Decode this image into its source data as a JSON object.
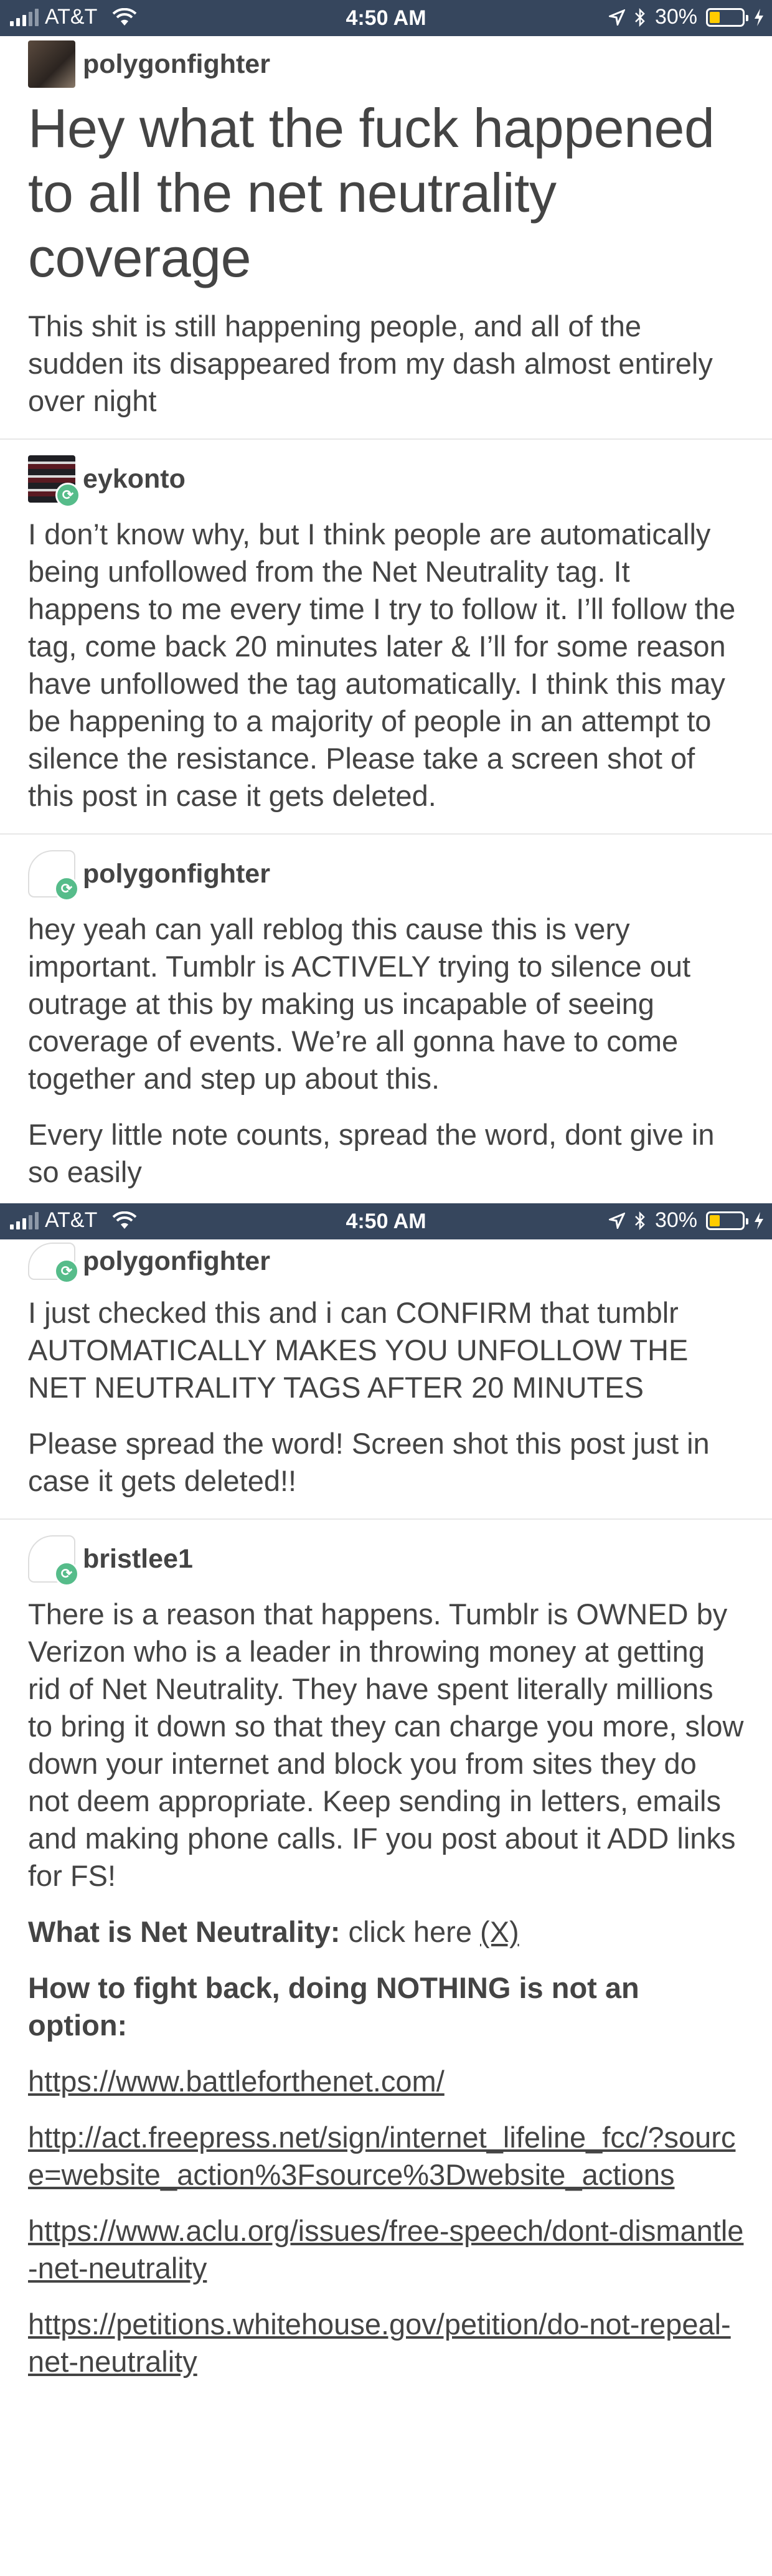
{
  "status_bar_top": {
    "carrier": "AT&T",
    "time": "4:50 AM",
    "battery": "30%",
    "battery_level": 0.3
  },
  "status_bar_mid": {
    "carrier": "AT&T",
    "time": "4:50 AM",
    "battery": "30%",
    "battery_level": 0.3
  },
  "colors": {
    "status_bar": "#36465d",
    "text": "#444444",
    "reblog_badge": "#56bc8a",
    "battery_fill": "#ffcc00"
  },
  "post": {
    "author": "polygonfighter",
    "title": "Hey what the fuck happened to all the net neutrality coverage",
    "body": "This shit is still happening people, and all of the sudden its disappeared from my dash almost entirely over night"
  },
  "reblogs": [
    {
      "author": "eykonto",
      "paragraphs": [
        "I don’t know why, but I think people are automatically being unfollowed from the Net Neutrality tag. It happens to me every time I try to follow it. I’ll follow the tag, come back 20 minutes later & I’ll for some reason have unfollowed the tag automatically. I think this may be happening to a majority of people in an attempt to silence the resistance. Please take a screen shot of this post in case it gets deleted."
      ]
    },
    {
      "author": "polygonfighter",
      "paragraphs": [
        "hey yeah can yall reblog this cause this is very important. Tumblr is ACTIVELY trying to silence out outrage at this by making us incapable of seeing coverage of events. We’re all gonna have to come together and step up about this.",
        "Every little note counts, spread the word, dont give in so easily"
      ]
    },
    {
      "author": "polygonfighter",
      "paragraphs": [
        "I just checked this and i can CONFIRM that tumblr AUTOMATICALLY MAKES YOU UNFOLLOW THE NET NEUTRALITY TAGS AFTER 20 MINUTES",
        "Please spread the word! Screen shot this post just in case it gets deleted!!"
      ]
    },
    {
      "author": "bristlee1",
      "paragraphs": [
        "There is a reason that happens. Tumblr is OWNED by Verizon who is a leader in throwing money at getting rid of Net Neutrality. They have spent literally millions to bring it down so that they can charge you more, slow down your internet and block you from sites they do not deem appropriate. Keep sending in letters, emails and making phone calls. IF you post about it ADD links for FS!"
      ],
      "what_is_label": "What is Net Neutrality:",
      "what_is_text": " click here ",
      "what_is_link": "(X)",
      "how_to_heading": "How to fight back, doing NOTHING is not an option:",
      "links": [
        "https://www.battleforthenet.com/",
        "http://act.freepress.net/sign/internet_lifeline_fcc/?source=website_action%3Fsource%3Dwebsite_actions",
        "https://www.aclu.org/issues/free-speech/dont-dismantle-net-neutrality",
        "https://petitions.whitehouse.gov/petition/do-not-repeal-net-neutrality"
      ]
    }
  ]
}
